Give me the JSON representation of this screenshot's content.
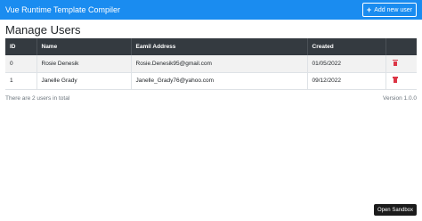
{
  "navbar": {
    "title": "Vue Runtime Template Compiler",
    "add_button_label": "Add new user"
  },
  "page": {
    "title": "Manage Users"
  },
  "table": {
    "headers": [
      "ID",
      "Name",
      "Eamil Address",
      "Created",
      ""
    ],
    "rows": [
      {
        "id": "0",
        "name": "Rosie Denesik",
        "email": "Rosie.Denesik95@gmail.com",
        "created": "01/05/2022"
      },
      {
        "id": "1",
        "name": "Janelle Grady",
        "email": "Janelle_Grady76@yahoo.com",
        "created": "09/12/2022"
      }
    ]
  },
  "footer": {
    "count_text": "There are 2 users in total",
    "version_text": "Version 1.0.0"
  },
  "sandbox": {
    "label": "Open Sandbox"
  },
  "colors": {
    "navbar": "#1a8cf0",
    "table_header": "#343a40",
    "delete": "#dc3545"
  }
}
